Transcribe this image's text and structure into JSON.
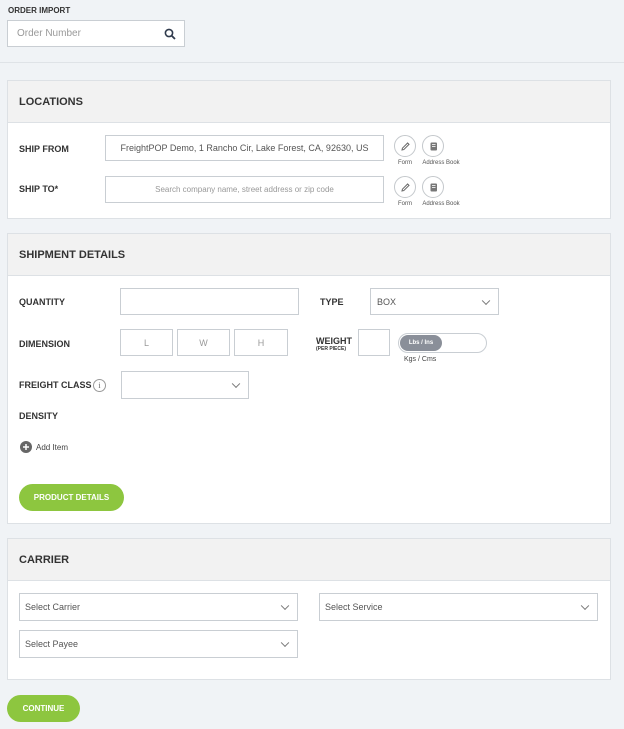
{
  "order_import": {
    "title": "ORDER IMPORT",
    "search_placeholder": "Order Number",
    "search_icon": "search-icon"
  },
  "locations": {
    "title": "LOCATIONS",
    "ship_from_label": "SHIP FROM",
    "ship_from_value": "FreightPOP Demo, 1 Rancho Cir, Lake Forest, CA, 92630, US",
    "ship_to_label": "SHIP TO*",
    "ship_to_placeholder": "Search company name, street address or zip code",
    "form_label": "Form",
    "address_book_label": "Address Book"
  },
  "shipment": {
    "title": "SHIPMENT DETAILS",
    "quantity_label": "QUANTITY",
    "type_label": "TYPE",
    "type_value": "BOX",
    "dimension_label": "DIMENSION",
    "dim_l": "L",
    "dim_w": "W",
    "dim_h": "H",
    "weight_label": "WEIGHT",
    "weight_sub": "(PER PIECE)",
    "unit_active": "Lbs / Ins",
    "unit_other": "Kgs / Cms",
    "freight_class_label": "FREIGHT CLASS",
    "info_icon_text": "i",
    "density_label": "DENSITY",
    "add_item_label": "Add Item",
    "product_details_label": "PRODUCT DETAILS"
  },
  "carrier": {
    "title": "CARRIER",
    "select_carrier": "Select Carrier",
    "select_service": "Select Service",
    "select_payee": "Select Payee"
  },
  "continue_label": "CONTINUE",
  "colors": {
    "accent_green": "#8dc63f",
    "toggle_gray": "#8a8f99"
  }
}
